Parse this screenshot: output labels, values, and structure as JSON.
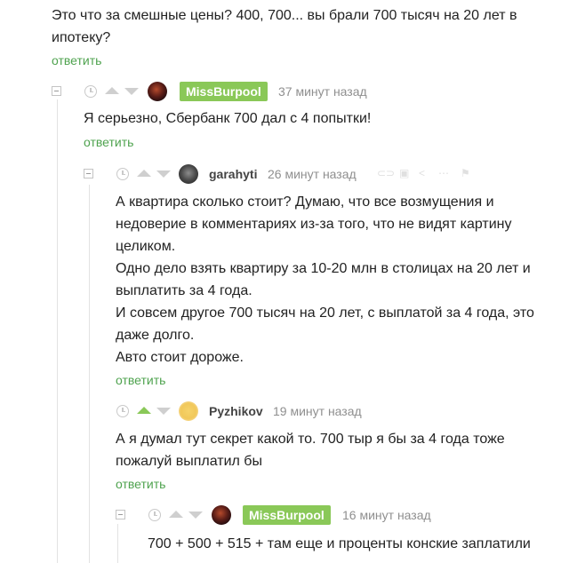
{
  "top": {
    "text_lines": [
      "Это что за смешные цены? 400, 700... вы брали 700 тысяч на 20 лет в",
      "ипотеку?"
    ],
    "reply": "ответить"
  },
  "c1": {
    "user": "MissBurpool",
    "time": "37 минут назад",
    "text_lines": [
      "Я серьезно, Сбербанк 700 дал с 4 попытки!"
    ],
    "reply": "ответить"
  },
  "c2": {
    "user": "garahyti",
    "time": "26 минут назад",
    "text_lines": [
      "А квартира сколько стоит? Думаю, что все возмущения и",
      "недоверие в комментариях из-за того, что не видят картину",
      "целиком.",
      "Одно дело взять квартиру за 10-20 млн в столицах на 20 лет и",
      "выплатить за 4 года.",
      "И совсем другое 700 тысяч на 20 лет, с выплатой за 4 года, это",
      "даже долго.",
      "Авто стоит дороже."
    ],
    "reply": "ответить"
  },
  "c3": {
    "user": "Pyzhikov",
    "time": "19 минут назад",
    "text_lines": [
      "А я думал тут секрет какой то. 700 тыр я бы за 4 года тоже",
      "пожалуй выплатил бы"
    ],
    "reply": "ответить"
  },
  "c4": {
    "user": "MissBurpool",
    "time": "16 минут назад",
    "text_lines": [
      "700 + 500 + 515 + там еще и проценты конские заплатили"
    ]
  },
  "colors": {
    "accent": "#8ac858",
    "link": "#4fa34f"
  }
}
